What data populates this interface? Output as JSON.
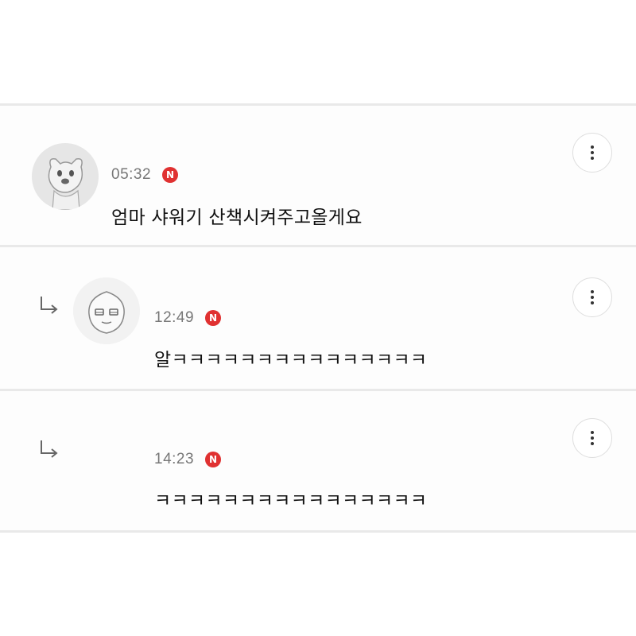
{
  "comments": [
    {
      "time": "05:32",
      "badge": "N",
      "text": "엄마 샤워기 산책시켜주고올게요",
      "avatar": "dog-character-icon",
      "is_reply": false
    },
    {
      "time": "12:49",
      "badge": "N",
      "text": "알ㅋㅋㅋㅋㅋㅋㅋㅋㅋㅋㅋㅋㅋㅋㅋ",
      "avatar": "peach-character-icon",
      "is_reply": true
    },
    {
      "time": "14:23",
      "badge": "N",
      "text": "ㅋㅋㅋㅋㅋㅋㅋㅋㅋㅋㅋㅋㅋㅋㅋㅋ",
      "avatar": "",
      "is_reply": true
    }
  ],
  "icons": {
    "more": "more-vertical-icon",
    "reply": "reply-arrow-icon",
    "new": "new-badge-icon"
  },
  "colors": {
    "badge": "#e03131",
    "time": "#777777",
    "text": "#111111",
    "divider": "#e9e9e9"
  }
}
